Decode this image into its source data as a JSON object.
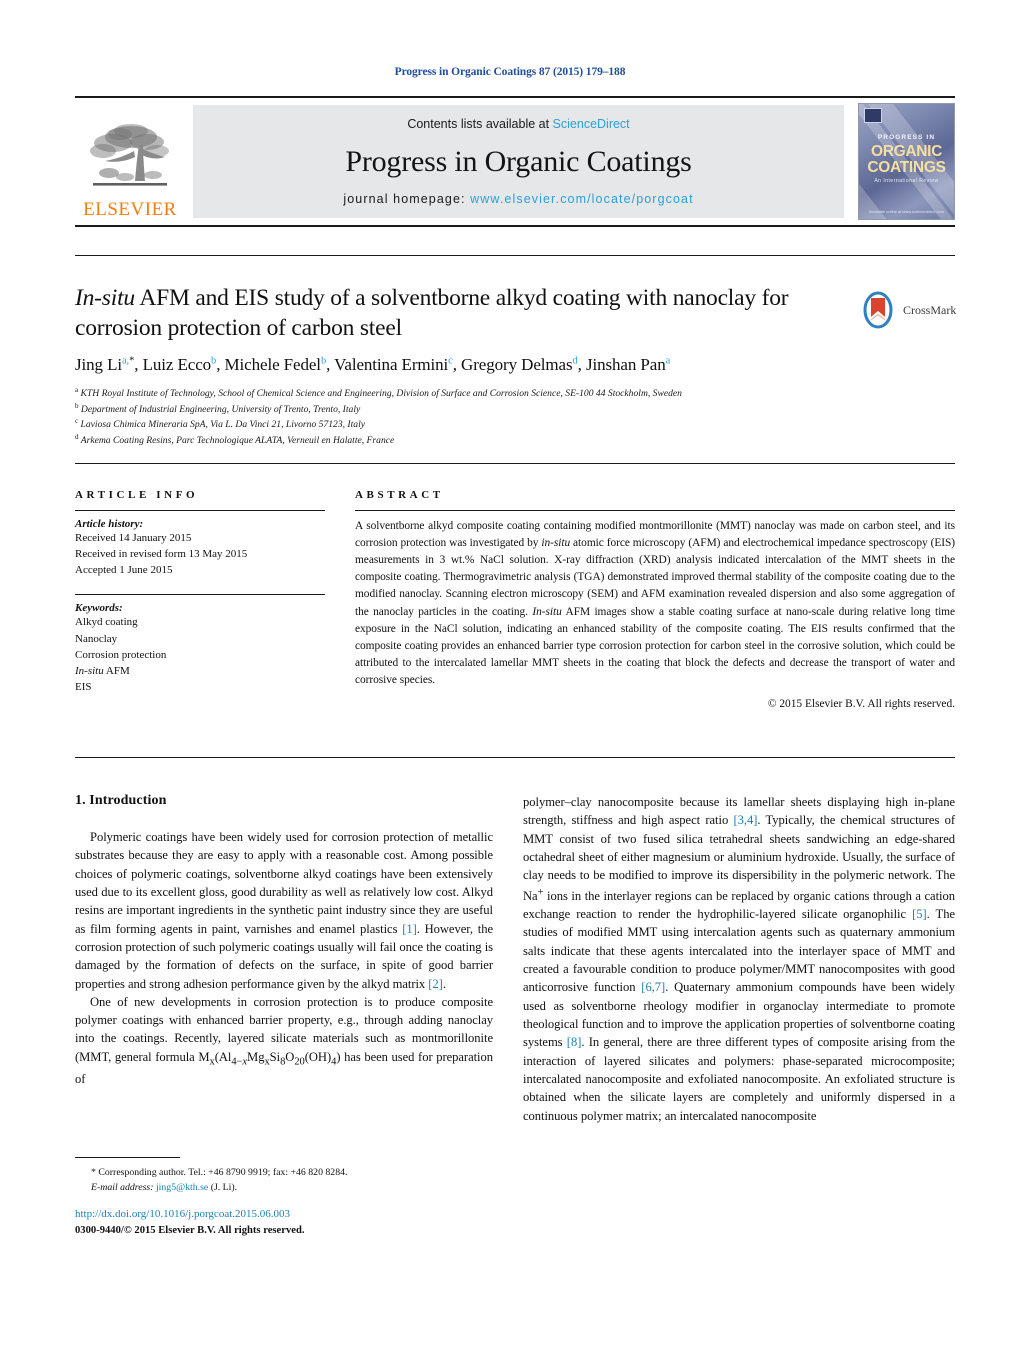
{
  "running_head": "Progress in Organic Coatings 87 (2015) 179–188",
  "masthead": {
    "contents_prefix": "Contents lists available at ",
    "contents_link": "ScienceDirect",
    "journal_title": "Progress in Organic Coatings",
    "homepage_prefix": "journal homepage: ",
    "homepage_url": "www.elsevier.com/locate/porgcoat",
    "publisher": "ELSEVIER",
    "cover": {
      "progress": "PROGRESS IN",
      "organic": "ORGANIC",
      "coatings": "COATINGS",
      "subtitle": "An International Review",
      "footer": "Available online at www.sciencedirect.com"
    }
  },
  "article": {
    "title_part1_italic": "In-situ",
    "title_rest": " AFM and EIS study of a solventborne alkyd coating with nanoclay for corrosion protection of carbon steel",
    "crossmark_label": "CrossMark",
    "authors": [
      {
        "name": "Jing Li",
        "sup": "a",
        "star": true
      },
      {
        "name": "Luiz Ecco",
        "sup": "b",
        "star": false
      },
      {
        "name": "Michele Fedel",
        "sup": "b",
        "star": false
      },
      {
        "name": "Valentina Ermini",
        "sup": "c",
        "star": false
      },
      {
        "name": "Gregory Delmas",
        "sup": "d",
        "star": false
      },
      {
        "name": "Jinshan Pan",
        "sup": "a",
        "star": false
      }
    ],
    "affiliations": [
      {
        "marker": "a",
        "text": "KTH Royal Institute of Technology, School of Chemical Science and Engineering, Division of Surface and Corrosion Science, SE-100 44 Stockholm, Sweden"
      },
      {
        "marker": "b",
        "text": "Department of Industrial Engineering, University of Trento, Trento, Italy"
      },
      {
        "marker": "c",
        "text": "Laviosa Chimica Mineraria SpA, Via L. Da Vinci 21, Livorno 57123, Italy"
      },
      {
        "marker": "d",
        "text": "Arkema Coating Resins, Parc Technologique ALATA, Verneuil en Halatte, France"
      }
    ]
  },
  "info": {
    "heading": "ARTICLE INFO",
    "history_label": "Article history:",
    "history": [
      "Received 14 January 2015",
      "Received in revised form 13 May 2015",
      "Accepted 1 June 2015"
    ],
    "keywords_label": "Keywords:",
    "keywords": [
      "Alkyd coating",
      "Nanoclay",
      "Corrosion protection",
      "In-situ AFM",
      "EIS"
    ]
  },
  "abstract": {
    "heading": "ABSTRACT",
    "paragraph_1": "A solventborne alkyd composite coating containing modified montmorillonite (MMT) nanoclay was made on carbon steel, and its corrosion protection was investigated by ",
    "italic_1": "in-situ",
    "paragraph_2": " atomic force microscopy (AFM) and electrochemical impedance spectroscopy (EIS) measurements in 3 wt.% NaCl solution. X-ray diffraction (XRD) analysis indicated intercalation of the MMT sheets in the composite coating. Thermogravimetric analysis (TGA) demonstrated improved thermal stability of the composite coating due to the modified nanoclay. Scanning electron microscopy (SEM) and AFM examination revealed dispersion and also some aggregation of the nanoclay particles in the coating. ",
    "italic_2": "In-situ",
    "paragraph_3": " AFM images show a stable coating surface at nano-scale during relative long time exposure in the NaCl solution, indicating an enhanced stability of the composite coating. The EIS results confirmed that the composite coating provides an enhanced barrier type corrosion protection for carbon steel in the corrosive solution, which could be attributed to the intercalated lamellar MMT sheets in the coating that block the defects and decrease the transport of water and corrosive species.",
    "copyright": "© 2015 Elsevier B.V. All rights reserved."
  },
  "intro": {
    "heading": "1.  Introduction",
    "left_p1_a": "Polymeric coatings have been widely used for corrosion protection of metallic substrates because they are easy to apply with a reasonable cost. Among possible choices of polymeric coatings, solventborne alkyd coatings have been extensively used due to its excellent gloss, good durability as well as relatively low cost. Alkyd resins are important ingredients in the synthetic paint industry since they are useful as film forming agents in paint, varnishes and enamel plastics ",
    "left_p1_ref1": "[1]",
    "left_p1_b": ". However, the corrosion protection of such polymeric coatings usually will fail once the coating is damaged by the formation of defects on the surface, in spite of good barrier properties and strong adhesion performance given by the alkyd matrix ",
    "left_p1_ref2": "[2]",
    "left_p1_c": ".",
    "left_p2_a": "One of new developments in corrosion protection is to produce composite polymer coatings with enhanced barrier property, e.g., through adding nanoclay into the coatings. Recently, layered silicate materials such as montmorillonite (MMT, general formula M",
    "formula": "M_x(Al_{4−x}Mg_xSi_8O_{20}(OH)_4)",
    "left_p2_b": ") has been used for preparation of",
    "right_a": "polymer–clay nanocomposite because its lamellar sheets displaying high in-plane strength, stiffness and high aspect ratio ",
    "right_ref1": "[3,4]",
    "right_b": ". Typically, the chemical structures of MMT consist of two fused silica tetrahedral sheets sandwiching an edge-shared octahedral sheet of either magnesium or aluminium hydroxide. Usually, the surface of clay needs to be modified to improve its dispersibility in the polymeric network. The Na",
    "right_sup_plus": "+",
    "right_c": " ions in the interlayer regions can be replaced by organic cations through a cation exchange reaction to render the hydrophilic-layered silicate organophilic ",
    "right_ref2": "[5]",
    "right_d": ". The studies of modified MMT using intercalation agents such as quaternary ammonium salts indicate that these agents intercalated into the interlayer space of MMT and created a favourable condition to produce polymer/MMT nanocomposites with good anticorrosive function ",
    "right_ref3": "[6,7]",
    "right_e": ". Quaternary ammonium compounds have been widely used as solventborne rheology modifier in organoclay intermediate to promote theological function and to improve the application properties of solventborne coating systems ",
    "right_ref4": "[8]",
    "right_f": ". In general, there are three different types of composite arising from the interaction of layered silicates and polymers: phase-separated microcomposite; intercalated nanocomposite and exfoliated nanocomposite. An exfoliated structure is obtained when the silicate layers are completely and uniformly dispersed in a continuous polymer matrix; an intercalated nanocomposite"
  },
  "footnote": {
    "star": "*",
    "corresponding": "Corresponding author. Tel.: +46 8790 9919; fax: +46 820 8284.",
    "email_label": "E-mail address:",
    "email": "jing5@kth.se",
    "email_suffix": " (J. Li)."
  },
  "footer": {
    "doi": "http://dx.doi.org/10.1016/j.porgcoat.2015.06.003",
    "issn": "0300-9440/© 2015 Elsevier B.V. All rights reserved."
  },
  "colors": {
    "link_blue": "#1a7fb5",
    "header_blue": "#1f4e9c",
    "sciencedirect_blue": "#2aa1d6",
    "elsevier_orange": "#F07F13"
  }
}
